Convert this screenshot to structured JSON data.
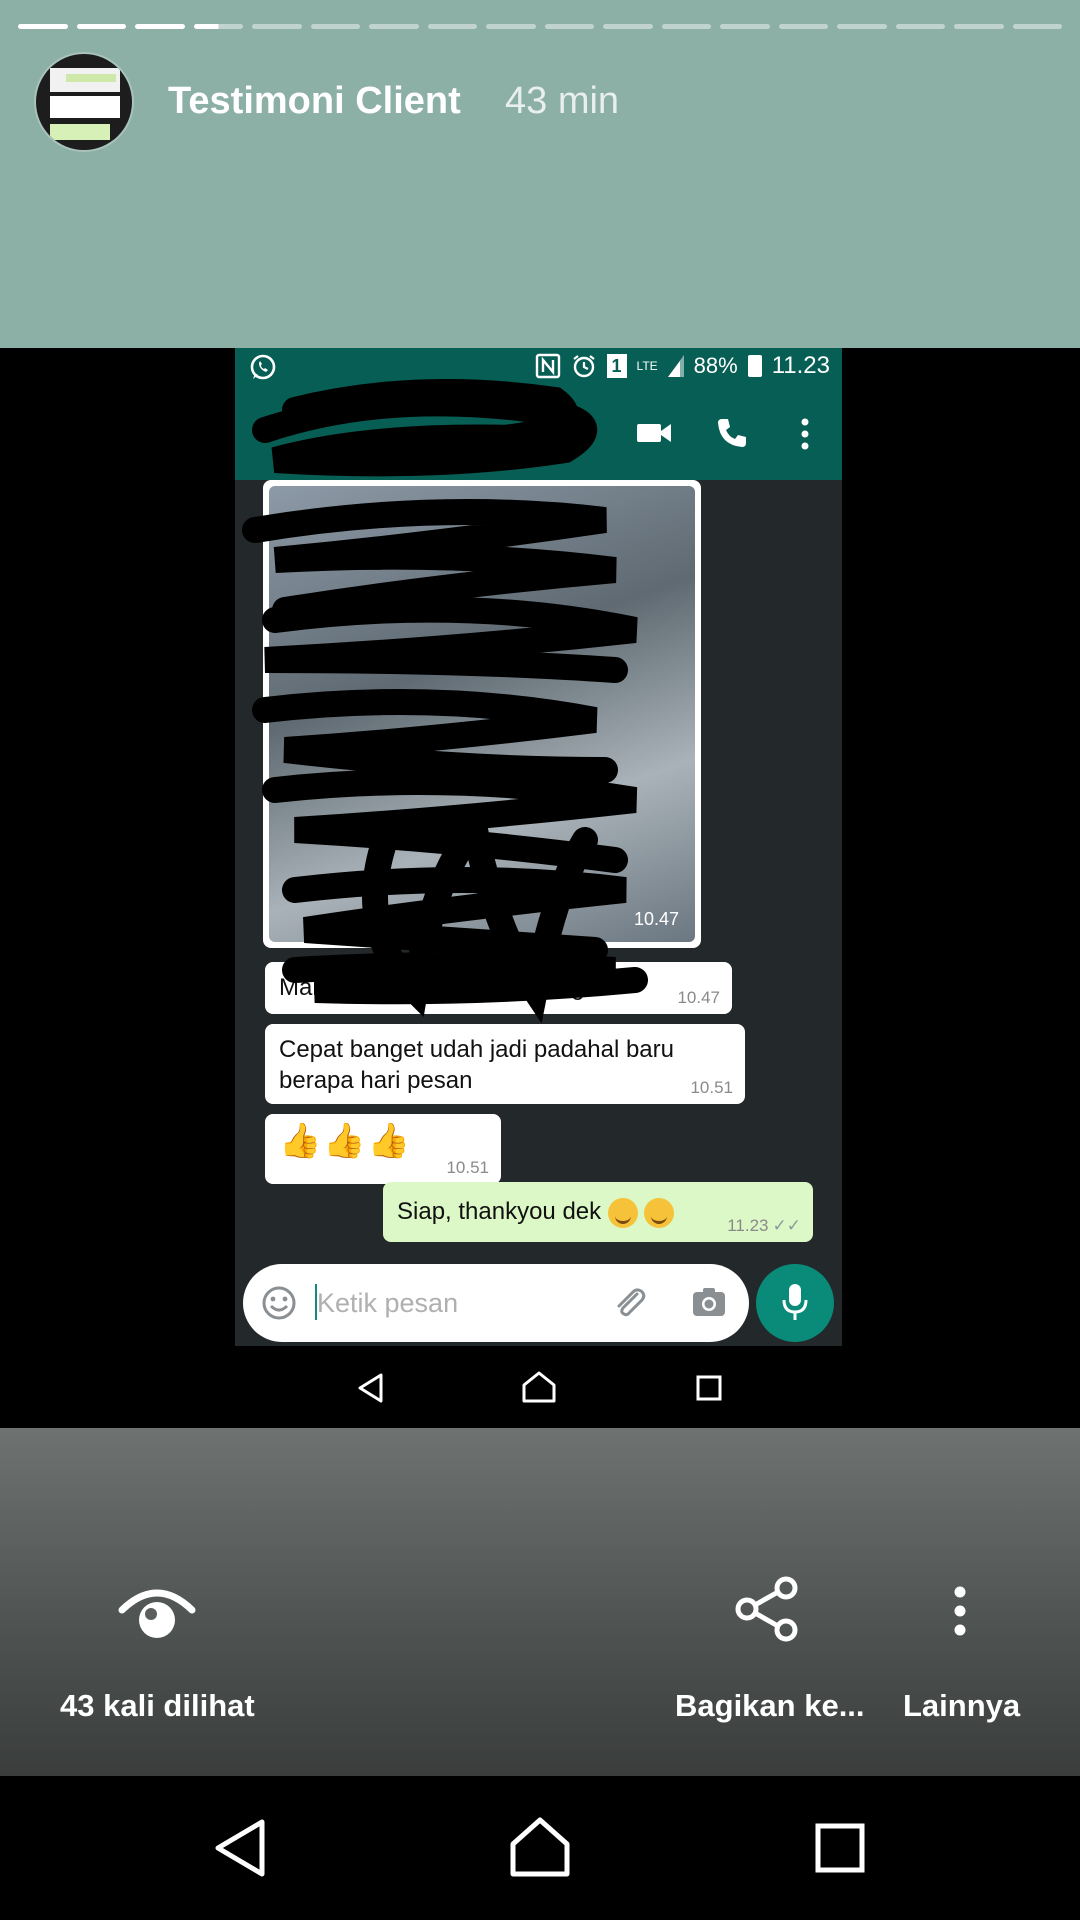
{
  "story": {
    "title": "Testimoni Client",
    "time_ago": "43 min",
    "segments_total": 18,
    "segments_done": 3
  },
  "status_bar": {
    "battery": "88%",
    "clock": "11.23",
    "sim": "1",
    "network": "LTE"
  },
  "chat": {
    "image_time": "10.47",
    "messages": [
      {
        "text": "Makasih kak aplikasinya bagus",
        "time": "10.47",
        "direction": "in"
      },
      {
        "text": "Cepat banget udah jadi padahal baru",
        "text2": "berapa hari pesan",
        "time": "10.51",
        "direction": "in"
      },
      {
        "text": "👍👍👍",
        "time": "10.51",
        "direction": "in"
      },
      {
        "text": "Siap, thankyou dek",
        "time": "11.23",
        "direction": "out"
      }
    ],
    "input_placeholder": "Ketik pesan"
  },
  "actions": {
    "views": "43 kali dilihat",
    "share": "Bagikan ke...",
    "more": "Lainnya"
  },
  "colors": {
    "header_bg": "#8cafa6",
    "whatsapp_green": "#075e54",
    "mic_green": "#0a8a79",
    "outgoing_bubble": "#dcf8c6"
  },
  "icons": [
    "whatsapp-icon",
    "nfc-icon",
    "alarm-icon",
    "video-call-icon",
    "phone-icon",
    "more-vert-icon",
    "emoji-icon",
    "attach-icon",
    "camera-icon",
    "mic-icon",
    "eye-icon",
    "share-icon",
    "back-icon",
    "home-icon",
    "recents-icon"
  ]
}
